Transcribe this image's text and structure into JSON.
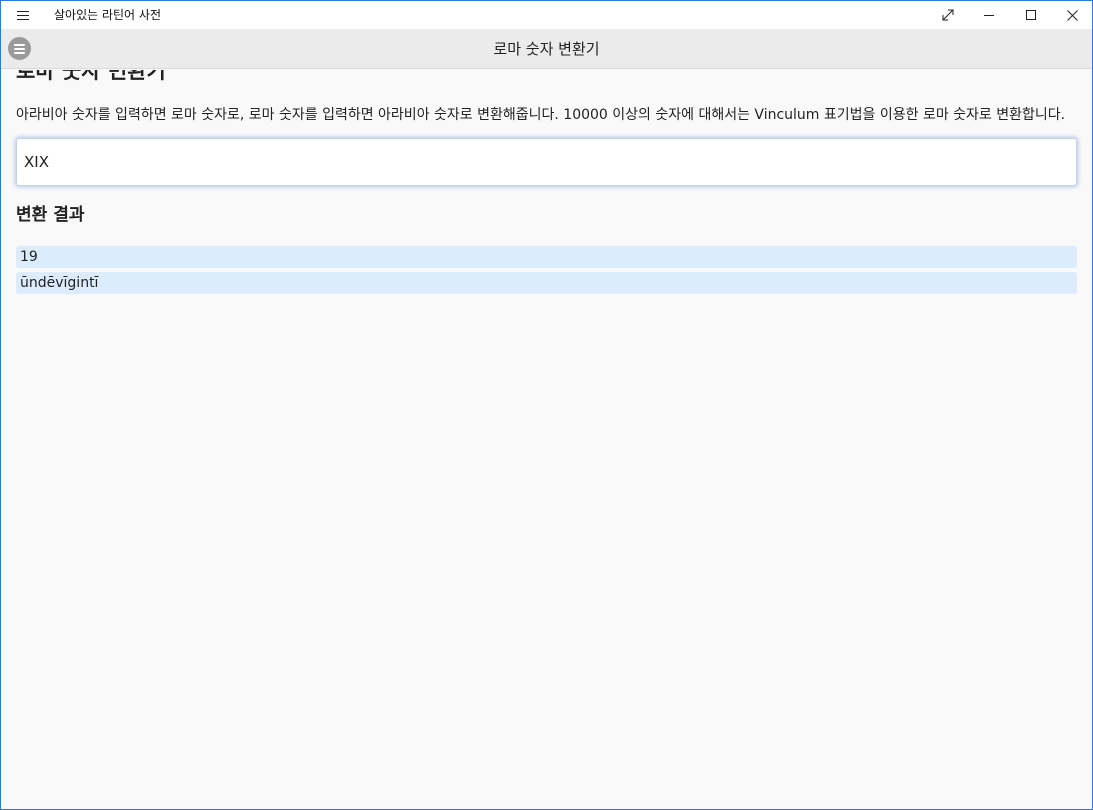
{
  "window": {
    "app_title": "살아있는 라틴어 사전",
    "controls": {
      "expand": "⤢",
      "minimize": "—",
      "maximize": "☐",
      "close": "✕"
    }
  },
  "header": {
    "title": "로마 숫자 변환기"
  },
  "main": {
    "heading": "로마 숫자 변환기",
    "description": "아라비아 숫자를 입력하면 로마 숫자로, 로마 숫자를 입력하면 아라비아 숫자로 변환해줍니다. 10000 이상의 숫자에 대해서는 Vinculum 표기법을 이용한 로마 숫자로 변환합니다.",
    "input_value": "XIX",
    "results_heading": "변환 결과",
    "results": [
      "19",
      "ūndēvīgintī"
    ]
  },
  "colors": {
    "accent": "#2b7bd8",
    "result_bg": "#dcecfd",
    "header_bg": "#ebebeb"
  }
}
